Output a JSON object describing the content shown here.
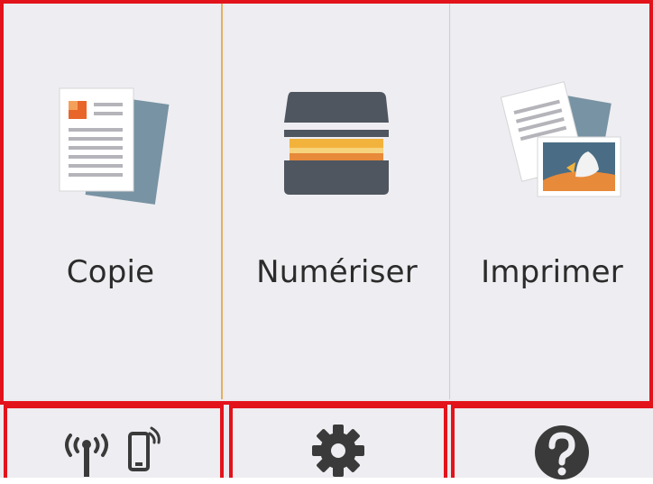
{
  "menu": {
    "copy_label": "Copie",
    "scan_label": "Numériser",
    "print_label": "Imprimer"
  },
  "bottom_bar": {
    "network_icon": "wireless-and-phone-icon",
    "settings_icon": "gear-icon",
    "help_icon": "help-question-icon"
  },
  "colors": {
    "highlight": "#e3131b",
    "selected_border": "#e3b060",
    "panel_bg": "#eeedf1",
    "text": "#2b2b2b"
  }
}
